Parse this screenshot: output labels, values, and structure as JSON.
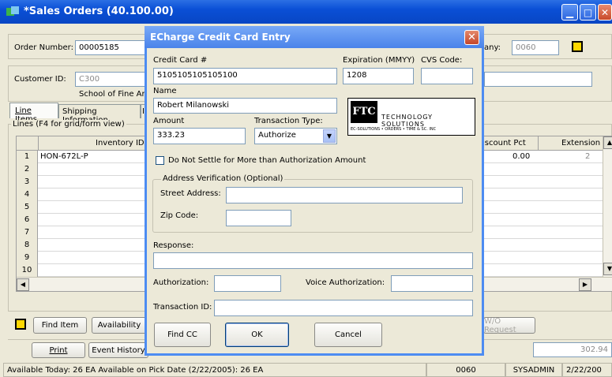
{
  "window": {
    "title": "*Sales Orders (40.100.00)"
  },
  "header": {
    "order_number_label": "Order Number:",
    "order_number": "00005185",
    "company_label": "any:",
    "company_value": "0060",
    "customer_id_label": "Customer ID:",
    "customer_id": "C300",
    "customer_name": "School of Fine Art"
  },
  "tabs": [
    "Line Items",
    "Shipping Information",
    "I"
  ],
  "lines": {
    "caption": "Lines (F4 for grid/form view)",
    "columns": {
      "inventory_id": "Inventory ID",
      "discount_pct": "iscount Pct",
      "extension": "Extension"
    },
    "row_numbers": [
      "1",
      "2",
      "3",
      "4",
      "5",
      "6",
      "7",
      "8",
      "9",
      "10"
    ],
    "first_row": {
      "inventory_id": "HON-672L-P",
      "discount_pct": "0.00",
      "extension": "2"
    }
  },
  "bottom_buttons": {
    "find_item": "Find Item",
    "availability": "Availability",
    "wo_request": "W/O Request",
    "print": "Print",
    "event_history": "Event History",
    "total": "302.94"
  },
  "status_bar": {
    "message": "Available Today: 26 EA   Available on Pick Date (2/22/2005): 26 EA",
    "company": "0060",
    "user": "SYSADMIN",
    "date": "2/22/200"
  },
  "dialog": {
    "title": "ECharge Credit Card Entry",
    "credit_card_label": "Credit Card #",
    "credit_card": "5105105105105100",
    "expiration_label": "Expiration (MMYY)",
    "expiration": "1208",
    "cvs_label": "CVS Code:",
    "cvs": "",
    "name_label": "Name",
    "name": "Robert Milanowski",
    "amount_label": "Amount",
    "amount": "333.23",
    "transaction_type_label": "Transaction Type:",
    "transaction_type": "Authorize",
    "logo_text": "TECHNOLOGY SOLUTIONS",
    "logo_subtext": "EC-SOLUTIONS • ORDERS • TIME & SC. INC",
    "no_settle_label": "Do Not Settle for More than Authorization Amount",
    "address_group_label": "Address Verification (Optional)",
    "street_label": "Street Address:",
    "street": "",
    "zip_label": "Zip Code:",
    "zip": "",
    "response_label": "Response:",
    "response": "",
    "authorization_label": "Authorization:",
    "authorization": "",
    "voice_auth_label": "Voice Authorization:",
    "voice_auth": "",
    "transaction_id_label": "Transaction ID:",
    "transaction_id": "",
    "find_cc": "Find CC",
    "ok": "OK",
    "cancel": "Cancel"
  },
  "colors": {
    "titlebar": "#0a4fd6",
    "dialog_titlebar": "#4a83ea",
    "close_red": "#c84a2a"
  }
}
